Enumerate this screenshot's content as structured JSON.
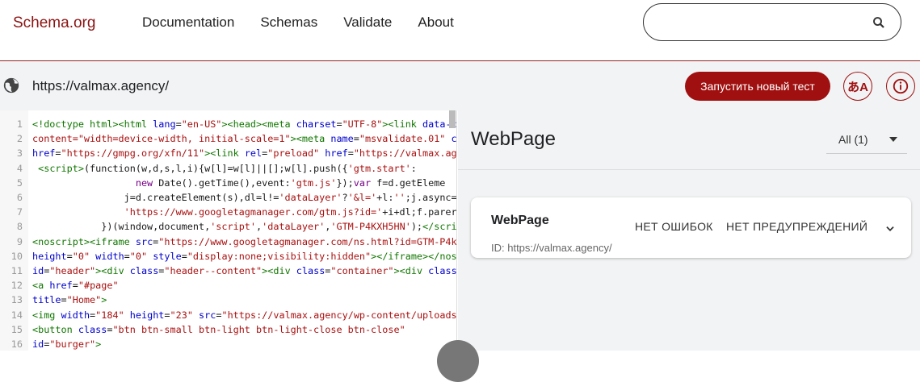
{
  "header": {
    "logo": "Schema.org",
    "nav": [
      "Documentation",
      "Schemas",
      "Validate",
      "About"
    ],
    "search": {
      "value": "",
      "placeholder": ""
    }
  },
  "urlbar": {
    "url": "https://valmax.agency/",
    "run_label": "Запустить новый тест",
    "lang_label": "あA"
  },
  "code_lines": [
    {
      "n": "1",
      "html": "<span class=\"t\">&lt;!doctype html&gt;&lt;html</span> <span class=\"a\">lang</span>=<span class=\"s\">\"en-US\"</span><span class=\"t\">&gt;&lt;head&gt;&lt;meta</span> <span class=\"a\">charset</span>=<span class=\"s\">\"UTF-8\"</span><span class=\"t\">&gt;&lt;link</span> <span class=\"a\">data-c</span>"
    },
    {
      "n": "2",
      "html": "<span class=\"s\">content=\"width=device-width, initial-scale=1\"</span><span class=\"t\">&gt;&lt;meta</span> <span class=\"a\">name</span>=<span class=\"s\">\"msvalidate.01\"</span> <span class=\"a\">c</span>"
    },
    {
      "n": "3",
      "html": "<span class=\"a\">href</span>=<span class=\"s\">\"https://gmpg.org/xfn/11\"</span><span class=\"t\">&gt;&lt;link</span> <span class=\"a\">rel</span>=<span class=\"s\">\"preload\"</span> <span class=\"a\">href</span>=<span class=\"s\">\"https://valmax.ag</span>"
    },
    {
      "n": "4",
      "html": " <span class=\"t\">&lt;script&gt;</span>(function(w,d,s,l,i){w[l]=w[l]||[];w[l].push({<span class=\"s\">'gtm.start'</span>:"
    },
    {
      "n": "5",
      "html": "                  <span class=\"k\">new</span> Date().getTime(),event:<span class=\"s\">'gtm.js'</span>});<span class=\"k\">var</span> f=d.getEleme"
    },
    {
      "n": "6",
      "html": "                j=d.createElement(s),dl=l!=<span class=\"s\">'dataLayer'</span>?<span class=\"s\">'&amp;l='</span>+l:<span class=\"s\">''</span>;j.async="
    },
    {
      "n": "7",
      "html": "                <span class=\"s\">'https://www.googletagmanager.com/gtm.js?id='</span>+i+dl;f.parer"
    },
    {
      "n": "8",
      "html": "            })(window,document,<span class=\"s\">'script'</span>,<span class=\"s\">'dataLayer'</span>,<span class=\"s\">'GTM-P4KXH5HN'</span>);<span class=\"t\">&lt;/scri</span>"
    },
    {
      "n": "9",
      "html": "<span class=\"t\">&lt;noscript&gt;&lt;iframe</span> <span class=\"a\">src</span>=<span class=\"s\">\"https://www.googletagmanager.com/ns.html?id=GTM-P4k</span>"
    },
    {
      "n": "10",
      "html": "<span class=\"a\">height</span>=<span class=\"s\">\"0\"</span> <span class=\"a\">width</span>=<span class=\"s\">\"0\"</span> <span class=\"a\">style</span>=<span class=\"s\">\"display:none;visibility:hidden\"</span><span class=\"t\">&gt;&lt;/iframe&gt;&lt;/nos</span>"
    },
    {
      "n": "11",
      "html": "<span class=\"a\">id</span>=<span class=\"s\">\"header\"</span><span class=\"t\">&gt;&lt;div</span> <span class=\"a\">class</span>=<span class=\"s\">\"header--content\"</span><span class=\"t\">&gt;&lt;div</span> <span class=\"a\">class</span>=<span class=\"s\">\"container\"</span><span class=\"t\">&gt;&lt;div</span> <span class=\"a\">class</span>"
    },
    {
      "n": "12",
      "html": "<span class=\"t\">&lt;a</span> <span class=\"a\">href</span>=<span class=\"s\">\"#page\"</span>"
    },
    {
      "n": "13",
      "html": "<span class=\"a\">title</span>=<span class=\"s\">\"Home\"</span><span class=\"t\">&gt;</span>"
    },
    {
      "n": "14",
      "html": "<span class=\"t\">&lt;img</span> <span class=\"a\">width</span>=<span class=\"s\">\"184\"</span> <span class=\"a\">height</span>=<span class=\"s\">\"23\"</span> <span class=\"a\">src</span>=<span class=\"s\">\"https://valmax.agency/wp-content/uploads</span>"
    },
    {
      "n": "15",
      "html": "<span class=\"t\">&lt;button</span> <span class=\"a\">class</span>=<span class=\"s\">\"btn btn-small btn-light btn-light-close btn-close\"</span>"
    },
    {
      "n": "16",
      "html": "<span class=\"a\">id</span>=<span class=\"s\">\"burger\"</span><span class=\"t\">&gt;</span>"
    }
  ],
  "result": {
    "title": "WebPage",
    "filter": "All (1)",
    "card": {
      "type": "WebPage",
      "id": "ID: https://valmax.agency/",
      "errors": "НЕТ ОШИБОК",
      "warnings": "НЕТ ПРЕДУПРЕЖДЕНИЙ"
    }
  }
}
